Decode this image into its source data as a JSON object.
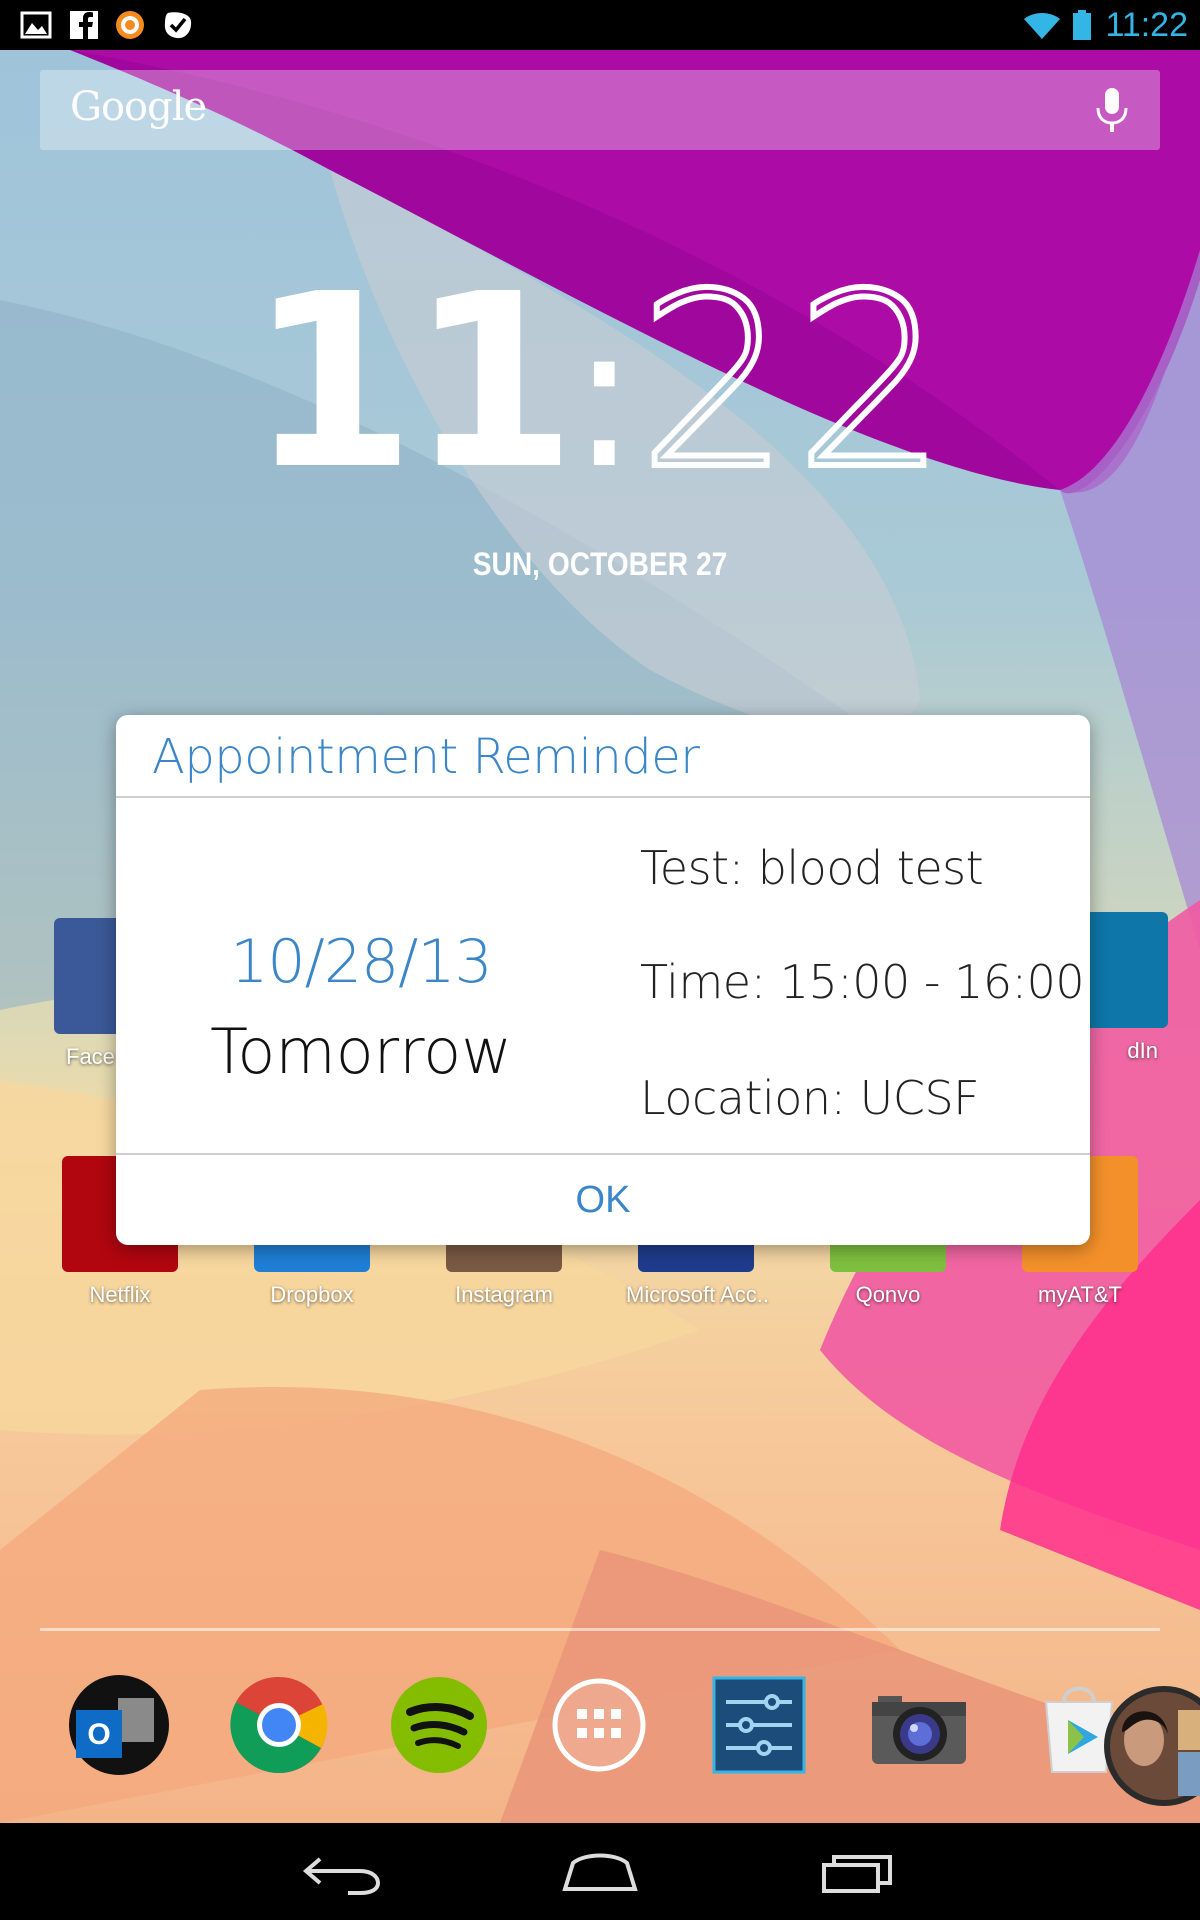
{
  "status_bar": {
    "time": "11:22",
    "left_icons": [
      "gallery-icon",
      "facebook-icon",
      "orange-app-icon",
      "checkmark-app-icon"
    ],
    "right_icons": [
      "wifi-icon",
      "battery-icon"
    ],
    "accent_color": "#33b5e5"
  },
  "search": {
    "logo": "Google",
    "icon": "mic-icon"
  },
  "clock": {
    "hours": "11",
    "colon": ":",
    "minutes": "22",
    "date": "SUN, OCTOBER 27"
  },
  "home_row_1": [
    {
      "label": "Face",
      "icon": "facebook-icon",
      "color": "#3b5998"
    },
    {
      "label": "dIn",
      "icon": "linkedin-icon",
      "color": "#0e76a8"
    }
  ],
  "home_row_2": [
    {
      "label": "Netflix",
      "icon": "netflix-icon",
      "color": "#b1060f"
    },
    {
      "label": "Dropbox",
      "icon": "dropbox-icon",
      "color": "#1f7fd6"
    },
    {
      "label": "Instagram",
      "icon": "instagram-icon",
      "color": "#7a5a44"
    },
    {
      "label": "Microsoft Acc..",
      "icon": "microsoft-account-icon",
      "color": "#1f3c8c"
    },
    {
      "label": "Qonvo",
      "icon": "qonvo-icon",
      "color": "#7fbf3f"
    },
    {
      "label": "myAT&T",
      "icon": "att-icon",
      "color": "#f3902a"
    }
  ],
  "dialog": {
    "title": "Appointment Reminder",
    "date": "10/28/13",
    "day": "Tomorrow",
    "test": "Test: blood test",
    "time": "Time: 15:00 - 16:00",
    "location": "Location: UCSF",
    "ok_label": "OK",
    "accent_color": "#3a86c8"
  },
  "dock": [
    "outlook-icon",
    "chrome-icon",
    "spotify-icon",
    "app-drawer-icon",
    "settings-sliders-icon",
    "camera-icon",
    "play-store-icon",
    "contact-photo-icon"
  ],
  "nav_bar": [
    "back-icon",
    "home-icon",
    "recents-icon"
  ]
}
